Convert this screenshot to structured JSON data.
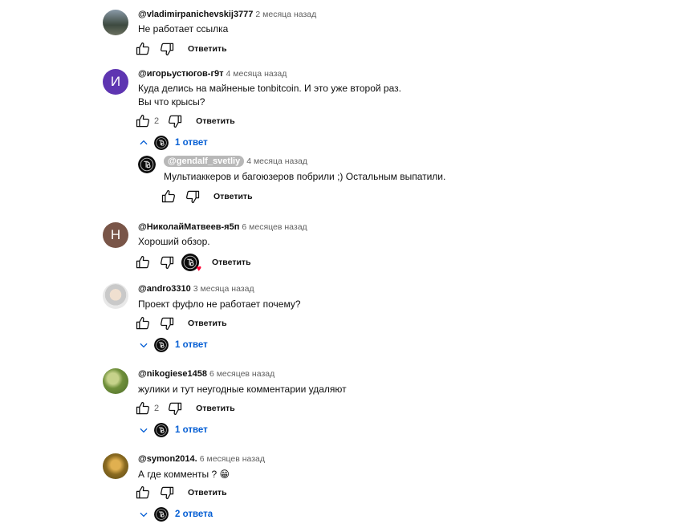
{
  "ui": {
    "reply_label": "Ответить",
    "heart_icon": "heart-icon"
  },
  "comments": [
    {
      "author": "@vladimirpanichevskij3777",
      "time": "2 месяца назад",
      "text": [
        "Не работает ссылка"
      ],
      "likes": ""
    },
    {
      "author": "@игорьустюгов-г9т",
      "time": "4 месяца назад",
      "avatar_letter": "И",
      "avatar_color": "#5e35b1",
      "text": [
        "Куда делись на майненые tonbitcoin. И это уже второй раз.",
        "Вы что крысы?"
      ],
      "likes": "2",
      "replies_toggle": "1 ответ",
      "reply": {
        "author": "@gendalf_svetliy",
        "time": "4 месяца назад",
        "text": "Мультиаккеров и багоюзеров побрили ;) Остальным выпатили."
      }
    },
    {
      "author": "@НиколайМатвеев-я5п",
      "time": "6 месяцев назад",
      "avatar_letter": "Н",
      "avatar_color": "#795548",
      "text": [
        "Хороший обзор."
      ],
      "likes": ""
    },
    {
      "author": "@andro3310",
      "time": "3 месяца назад",
      "text": [
        "Проект фуфло не работает почему?"
      ],
      "likes": "",
      "replies_toggle": "1 ответ"
    },
    {
      "author": "@nikogiese1458",
      "time": "6 месяцев назад",
      "text": [
        "жулики и тут неугодные комментарии удаляют"
      ],
      "likes": "2",
      "replies_toggle": "1 ответ"
    },
    {
      "author": "@symon2014.",
      "time": "6 месяцев назад",
      "text": [
        "А где комменты ? 😁"
      ],
      "likes": "",
      "replies_toggle": "2 ответа"
    }
  ]
}
